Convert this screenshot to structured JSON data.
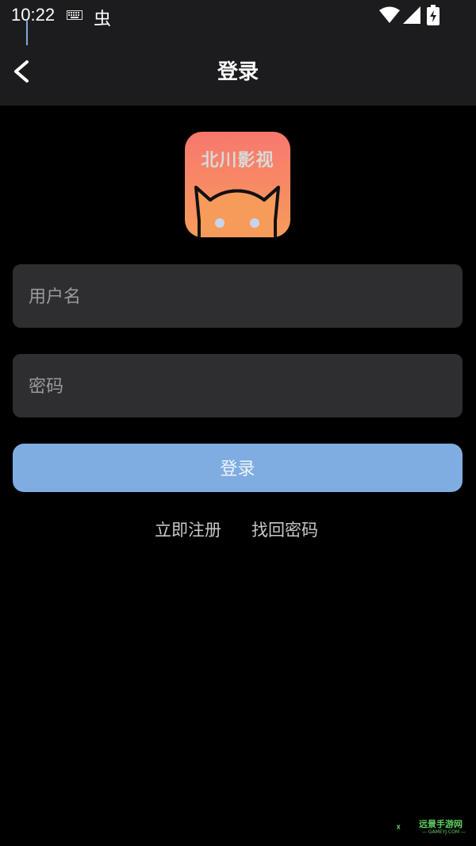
{
  "status_bar": {
    "time": "10:22",
    "keyboard_icon": "keyboard-icon",
    "bug_glyph": "虫",
    "wifi_icon": "wifi-icon",
    "signal_icon": "signal-icon",
    "battery_icon": "battery-charging-icon"
  },
  "app_bar": {
    "back_icon": "chevron-left-icon",
    "title": "登录"
  },
  "logo": {
    "text": "北川影视",
    "icon": "cat-face-icon",
    "colors": {
      "top": "#f7786f",
      "bottom": "#f79b5a"
    }
  },
  "form": {
    "username_placeholder": "用户名",
    "password_placeholder": "密码",
    "login_label": "登录"
  },
  "links": {
    "register": "立即注册",
    "forgot_password": "找回密码"
  },
  "watermark": {
    "text": "远景手游网",
    "sub": "— GAMEYJ.COM —"
  },
  "colors": {
    "background": "#000000",
    "bar": "#1c1c1e",
    "field": "#2e2e31",
    "accent": "#7fade1"
  }
}
